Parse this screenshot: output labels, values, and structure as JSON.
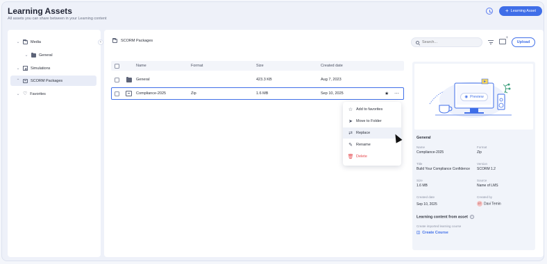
{
  "header": {
    "title": "Learning Assets",
    "subtitle": "All assets you can share between in your Learning content",
    "primary_button": "Learning Asset"
  },
  "sidebar": {
    "items": [
      {
        "label": "Media"
      },
      {
        "label": "General"
      },
      {
        "label": "Simulations"
      },
      {
        "label": "SCORM Packages"
      },
      {
        "label": "Favorites"
      }
    ]
  },
  "main": {
    "folder_title": "SCORM Packages",
    "search_placeholder": "Search...",
    "upload_label": "Upload",
    "columns": [
      "Name",
      "Format",
      "Size",
      "Created date"
    ],
    "rows": [
      {
        "name": "General",
        "format": "",
        "size": "423.3 KB",
        "created": "Aug 7, 2023"
      },
      {
        "name": "Compliance-2025",
        "format": "Zip",
        "size": "1.6 MB",
        "created": "Sep 10, 2025"
      }
    ]
  },
  "context_menu": {
    "items": [
      {
        "label": "Add to favorites",
        "icon": "star-outline-icon"
      },
      {
        "label": "Move to Folder",
        "icon": "move-icon"
      },
      {
        "label": "Replace",
        "icon": "replace-icon"
      },
      {
        "label": "Rename",
        "icon": "rename-icon"
      },
      {
        "label": "Delete",
        "icon": "trash-icon"
      }
    ]
  },
  "details": {
    "preview_label": "Preview",
    "section_title": "General",
    "name_label": "Name",
    "name_value": "Compliance-2025",
    "format_label": "Format",
    "format_value": "Zip",
    "title_label": "Title",
    "title_value": "Build Your Compliance Confidence",
    "version_label": "Version",
    "version_value": "SCORM 1.2",
    "size_label": "Size",
    "size_value": "1.6 MB",
    "source_label": "Source",
    "source_value": "Name of LMS",
    "created_date_label": "Created date",
    "created_date_value": "Sep 10, 2025",
    "created_by_label": "Created by",
    "created_by_value": "Davi Temin",
    "created_by_initials": "DT",
    "learning_content_title": "Learning content from asset",
    "create_imported_label": "Create imported learning course",
    "create_course_label": "Create Course"
  },
  "colors": {
    "accent": "#3f6ee8",
    "danger": "#e5484d",
    "background": "#eef1f9"
  }
}
